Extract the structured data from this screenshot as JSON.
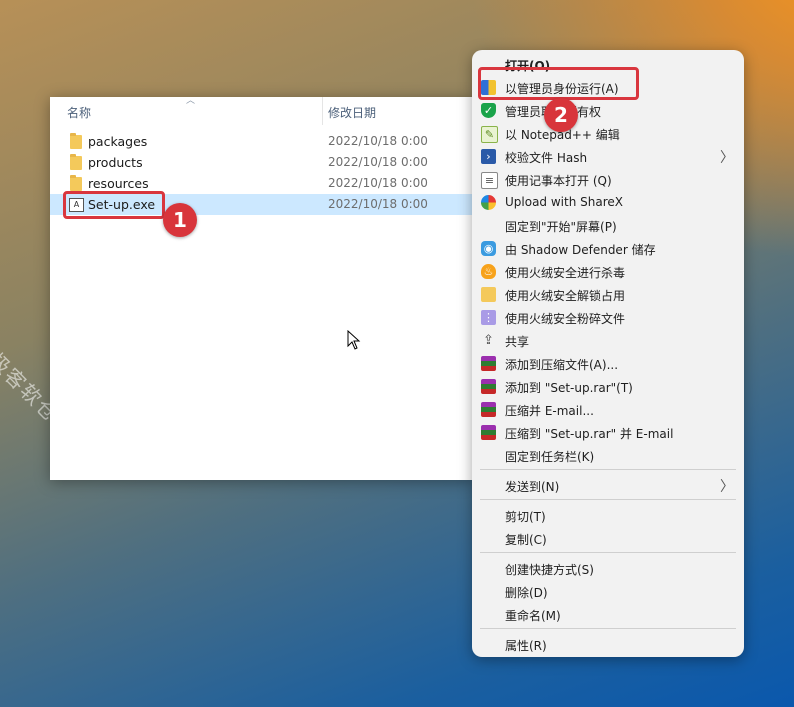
{
  "watermark": "极客软仓",
  "explorer": {
    "columns": {
      "name": "名称",
      "date": "修改日期"
    },
    "files": [
      {
        "name": "packages",
        "date": "2022/10/18 0:00",
        "type": "folder"
      },
      {
        "name": "products",
        "date": "2022/10/18 0:00",
        "type": "folder"
      },
      {
        "name": "resources",
        "date": "2022/10/18 0:00",
        "type": "folder"
      },
      {
        "name": "Set-up.exe",
        "date": "2022/10/18 0:00",
        "type": "exe"
      }
    ]
  },
  "badges": {
    "one": "1",
    "two": "2"
  },
  "menu": {
    "items": [
      {
        "label": "打开(O)",
        "icon": "none"
      },
      {
        "label": "以管理员身份运行(A)",
        "icon": "uac-shield-icon"
      },
      {
        "label": "管理员取得所有权",
        "icon": "green-shield-icon"
      },
      {
        "label": "以 Notepad++ 编辑",
        "icon": "notepadpp-icon"
      },
      {
        "label": "校验文件 Hash",
        "icon": "powershell-icon"
      },
      {
        "label": "使用记事本打开 (Q)",
        "icon": "notepad-icon"
      },
      {
        "label": "Upload with ShareX",
        "icon": "sharex-icon"
      },
      {
        "label": "固定到\"开始\"屏幕(P)",
        "icon": "none"
      },
      {
        "label": "由 Shadow Defender 储存",
        "icon": "shadow-defender-icon"
      },
      {
        "label": "使用火绒安全进行杀毒",
        "icon": "huorong-icon"
      },
      {
        "label": "使用火绒安全解锁占用",
        "icon": "folder-lock-icon"
      },
      {
        "label": "使用火绒安全粉碎文件",
        "icon": "shredder-icon"
      },
      {
        "label": "共享",
        "icon": "share-icon"
      },
      {
        "label": "添加到压缩文件(A)...",
        "icon": "winrar-icon"
      },
      {
        "label": "添加到 \"Set-up.rar\"(T)",
        "icon": "winrar-icon"
      },
      {
        "label": "压缩并 E-mail...",
        "icon": "winrar-icon"
      },
      {
        "label": "压缩到 \"Set-up.rar\" 并 E-mail",
        "icon": "winrar-icon"
      },
      {
        "label": "固定到任务栏(K)",
        "icon": "none"
      },
      {
        "label": "发送到(N)",
        "icon": "none"
      },
      {
        "label": "剪切(T)",
        "icon": "none"
      },
      {
        "label": "复制(C)",
        "icon": "none"
      },
      {
        "label": "创建快捷方式(S)",
        "icon": "none"
      },
      {
        "label": "删除(D)",
        "icon": "none"
      },
      {
        "label": "重命名(M)",
        "icon": "none"
      },
      {
        "label": "属性(R)",
        "icon": "none"
      }
    ]
  },
  "colors": {
    "accent_red": "#d8353b",
    "selection": "#cce8ff",
    "menu_bg": "#f2f2f2"
  }
}
